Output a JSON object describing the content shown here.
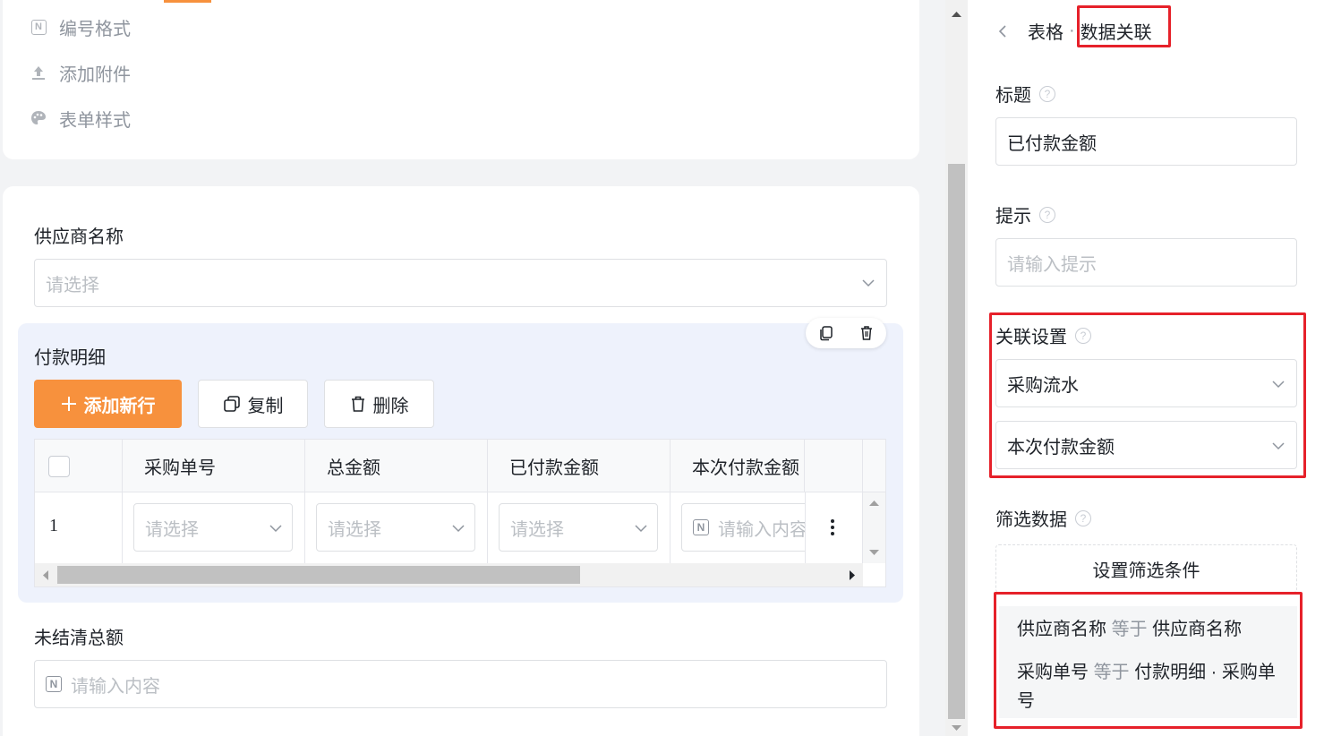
{
  "menu": [
    {
      "label": "编号格式",
      "icon": "number-icon"
    },
    {
      "label": "添加附件",
      "icon": "upload-icon"
    },
    {
      "label": "表单样式",
      "icon": "palette-icon"
    }
  ],
  "form": {
    "supplier_label": "供应商名称",
    "supplier_placeholder": "请选择",
    "subtable": {
      "title": "付款明细",
      "add_row": "添加新行",
      "copy": "复制",
      "delete": "删除",
      "columns": [
        "采购单号",
        "总金额",
        "已付款金额",
        "本次付款金额"
      ],
      "rows": [
        {
          "index": "1",
          "cells": [
            "请选择",
            "请选择",
            "请选择",
            "请输入内容"
          ]
        }
      ]
    },
    "unpaid_label": "未结清总额",
    "unpaid_placeholder": "请输入内容"
  },
  "panel": {
    "breadcrumb_parent": "表格",
    "breadcrumb_sep": "·",
    "breadcrumb_current": "数据关联",
    "title_label": "标题",
    "title_value": "已付款金额",
    "hint_label": "提示",
    "hint_placeholder": "请输入提示",
    "link_label": "关联设置",
    "link_source": "采购流水",
    "link_field": "本次付款金额",
    "filter_label": "筛选数据",
    "filter_button": "设置筛选条件",
    "conditions": [
      {
        "left": "供应商名称",
        "op": "等于",
        "right": "供应商名称"
      },
      {
        "left": "采购单号",
        "op": "等于",
        "right": "付款明细 · 采购单号"
      }
    ]
  },
  "colors": {
    "accent": "#f7913d",
    "highlight": "#e6212a",
    "subtable_bg": "#eef2fc"
  }
}
